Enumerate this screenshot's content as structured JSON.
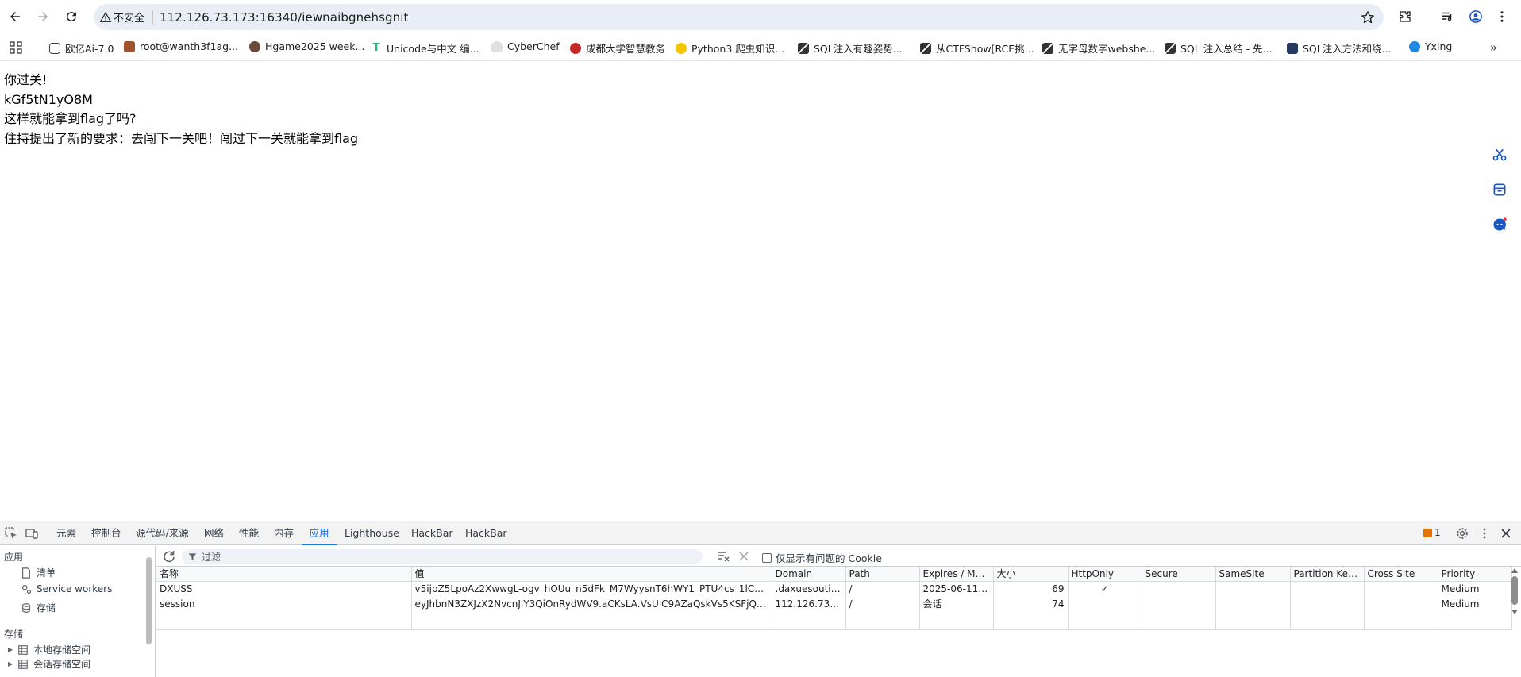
{
  "address_bar": {
    "security_label": "不安全",
    "url": "112.126.73.173:16340/iewnaibgnehsgnit"
  },
  "bookmarks": [
    {
      "label": "欧亿Ai-7.0",
      "icon": "chat-icon",
      "color": "#3c3c3c"
    },
    {
      "label": "root@wanth3f1ag...",
      "icon": "avatar-icon",
      "color": "#a0522d"
    },
    {
      "label": "Hgame2025 week...",
      "icon": "avatar-icon",
      "color": "#6b4a3a"
    },
    {
      "label": "Unicode与中文 编...",
      "icon": "t-icon",
      "color": "#2db37a"
    },
    {
      "label": "CyberChef",
      "icon": "chef-icon",
      "color": "#9e9e9e"
    },
    {
      "label": "成都大学智慧教务",
      "icon": "school-icon",
      "color": "#c62828"
    },
    {
      "label": "Python3 爬虫知识...",
      "icon": "hazard-icon",
      "color": "#f5c400"
    },
    {
      "label": "SQL注入有趣姿势...",
      "icon": "blog-icon",
      "color": "#333333"
    },
    {
      "label": "从CTFShow[RCE挑...",
      "icon": "blog-icon",
      "color": "#333333"
    },
    {
      "label": "无字母数字webshe...",
      "icon": "blog-icon",
      "color": "#333333"
    },
    {
      "label": "SQL 注入总结 - 先...",
      "icon": "blog-icon",
      "color": "#333333"
    },
    {
      "label": "SQL注入方法和绕...",
      "icon": "image-icon",
      "color": "#243a5e"
    },
    {
      "label": "Yxing",
      "icon": "globe-icon",
      "color": "#1e88e5"
    }
  ],
  "page": {
    "lines": [
      "你过关!",
      "kGf5tN1yO8M",
      "这样就能拿到flag了吗?",
      "住持提出了新的要求：去闯下一关吧！闯过下一关就能拿到flag"
    ]
  },
  "devtools": {
    "tabs": [
      "元素",
      "控制台",
      "源代码/来源",
      "网络",
      "性能",
      "内存",
      "应用",
      "Lighthouse",
      "HackBar",
      "HackBar"
    ],
    "active_tab": "应用",
    "issues_count": "1",
    "sidebar": {
      "section_app": "应用",
      "items": [
        "清单",
        "Service workers",
        "存储"
      ],
      "section_storage": "存储",
      "storage_items": [
        "本地存储空间",
        "会话存储空间"
      ]
    },
    "filter_placeholder": "过滤",
    "only_issues_label": "仅显示有问题的 Cookie",
    "columns": [
      "名称",
      "值",
      "Domain",
      "Path",
      "Expires / Ma...",
      "大小",
      "HttpOnly",
      "Secure",
      "SameSite",
      "Partition Key...",
      "Cross Site",
      "Priority"
    ],
    "rows": [
      {
        "name": "DXUSS",
        "value": "v5ijbZ5LpoAz2XwwgL-ogv_hOUu_n5dFk_M7WyysnT6hWY1_PTU4cs_1lCb73...",
        "domain": ".daxuesoutiji...",
        "path": "/",
        "expires": "2025-06-11T...",
        "size": "69",
        "httponly": "✓",
        "secure": "",
        "samesite": "",
        "partition": "",
        "crosssite": "",
        "priority": "Medium"
      },
      {
        "name": "session",
        "value": "eyJhbnN3ZXJzX2NvcnJlY3QiOnRydWV9.aCKsLA.VsUlC9AZaQskVs5KSFjQye...",
        "domain": "112.126.73.1...",
        "path": "/",
        "expires": "会话",
        "size": "74",
        "httponly": "",
        "secure": "",
        "samesite": "",
        "partition": "",
        "crosssite": "",
        "priority": "Medium"
      }
    ]
  }
}
